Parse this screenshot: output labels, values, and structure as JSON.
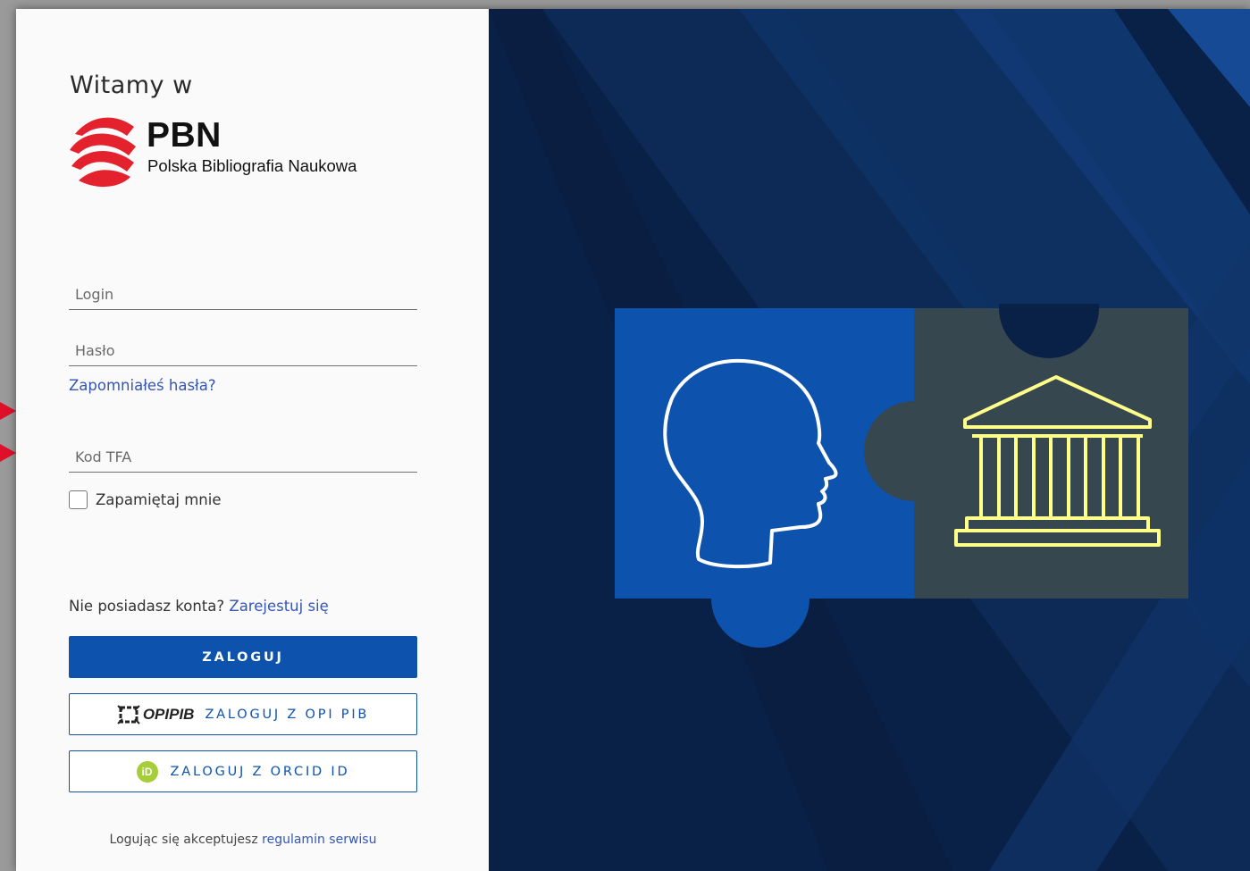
{
  "welcome": "Witamy w",
  "logo": {
    "title": "PBN",
    "subtitle": "Polska Bibliografia Naukowa",
    "brand_color": "#e3222e"
  },
  "form": {
    "login_placeholder": "Login",
    "password_placeholder": "Hasło",
    "forgot_password": "Zapomniałeś hasła?",
    "tfa_placeholder": "Kod TFA",
    "remember_me": "Zapamiętaj mnie",
    "no_account": "Nie posiadasz konta?",
    "register": "Zarejestuj się"
  },
  "buttons": {
    "login": "ZALOGUJ",
    "opi_logo": "OPIPIB",
    "opi_login": "ZALOGUJ Z OPI PIB",
    "orcid_icon": "iD",
    "orcid_login": "ZALOGUJ Z ORCID ID"
  },
  "footer": {
    "text": "Logując się akceptujesz",
    "link": "regulamin serwisu"
  },
  "colors": {
    "primary": "#0d52ad",
    "link": "#3455b4",
    "background_dark": "#0a2147",
    "puzzle_blue": "#0d52ad",
    "puzzle_gray": "#37474f",
    "temple_yellow": "#ffff8a",
    "annotation_arrow": "#e0102a"
  },
  "illustration": {
    "left_piece_icon": "head-profile-icon",
    "right_piece_icon": "institution-building-icon"
  }
}
